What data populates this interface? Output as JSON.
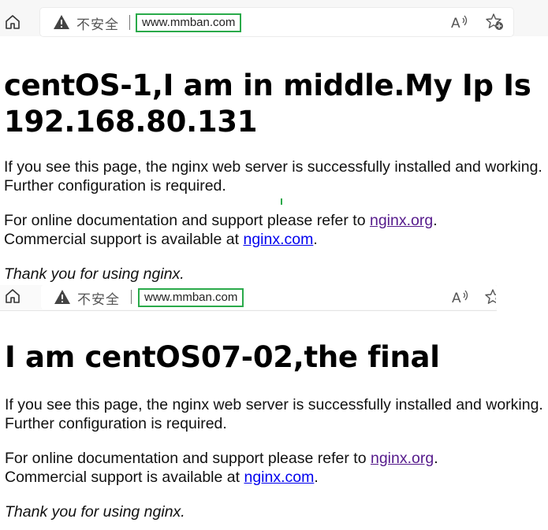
{
  "screenshots": [
    {
      "browser": {
        "security_label": "不安全",
        "url": "www.mmban.com",
        "home_icon": "home-icon",
        "warning_icon": "warning-triangle-icon",
        "read_aloud_icon": "read-aloud-icon",
        "favorites_icon": "add-favorite-star-icon"
      },
      "page": {
        "heading": "centOS-1,I am in middle.My Ip Is 192.168.80.131",
        "para1": "If you see this page, the nginx web server is successfully installed and working. Further configuration is required.",
        "para2_prefix": "For online documentation and support please refer to ",
        "link_org": "nginx.org",
        "para2_mid": ".",
        "para2_line2": "Commercial support is available at ",
        "link_com": "nginx.com",
        "para2_end": ".",
        "thanks": "Thank you for using nginx."
      }
    },
    {
      "browser": {
        "security_label": "不安全",
        "url": "www.mmban.com",
        "home_icon": "home-icon",
        "warning_icon": "warning-triangle-icon",
        "read_aloud_icon": "read-aloud-icon",
        "favorites_icon": "add-favorite-star-icon"
      },
      "page": {
        "heading": "I am centOS07-02,the final",
        "para1": "If you see this page, the nginx web server is successfully installed and working. Further configuration is required.",
        "para2_prefix": "For online documentation and support please refer to ",
        "link_org": "nginx.org",
        "para2_mid": ".",
        "para2_line2": "Commercial support is available at ",
        "link_com": "nginx.com",
        "para2_end": ".",
        "thanks": "Thank you for using nginx."
      }
    }
  ],
  "colors": {
    "url_highlight": "#2aaa4a",
    "link": "#0000ee",
    "visited_link": "#551a8b"
  }
}
